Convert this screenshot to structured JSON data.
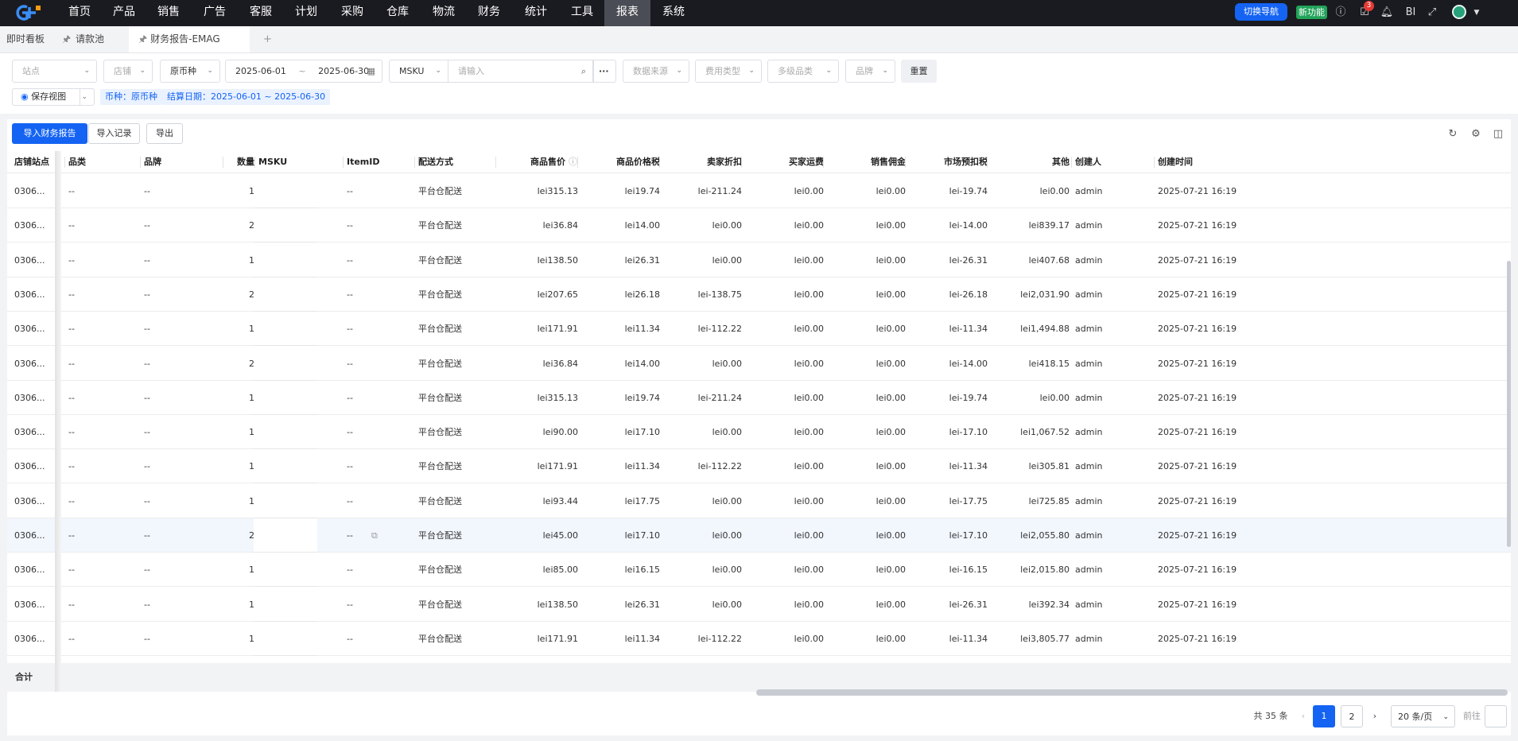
{
  "nav": {
    "items": [
      "首页",
      "产品",
      "销售",
      "广告",
      "客服",
      "计划",
      "采购",
      "仓库",
      "物流",
      "财务",
      "统计",
      "工具",
      "报表",
      "系统"
    ],
    "switch_label": "切换导航",
    "new_feature_label": "新功能",
    "notification_count": "3",
    "bi_label": "BI"
  },
  "tabs": {
    "dashboard": "即时看板",
    "request_pool": "请款池",
    "active": "财务报告-EMAG",
    "add": "+"
  },
  "filters": {
    "site": "站点",
    "shop": "店铺",
    "currency": "原币种",
    "date_start": "2025-06-01",
    "date_sep": "~",
    "date_end": "2025-06-30",
    "search_field": "MSKU",
    "search_placeholder": "请输入",
    "more": "···",
    "data_source": "数据来源",
    "fee_type": "费用类型",
    "category": "多级品类",
    "brand": "品牌",
    "reset": "重置",
    "save_view": "保存视图",
    "tag_currency": "币种：原币种",
    "tag_date": "结算日期：2025-06-01 ~ 2025-06-30"
  },
  "toolbar": {
    "import_report": "导入财务报告",
    "import_record": "导入记录",
    "export": "导出"
  },
  "table": {
    "headers": {
      "shop_site": "店铺站点",
      "category": "品类",
      "brand": "品牌",
      "qty": "数量",
      "msku": "MSKU",
      "item_id": "ItemID",
      "delivery": "配送方式",
      "price": "商品售价",
      "price_tax": "商品价格税",
      "seller_discount": "卖家折扣",
      "buyer_shipping": "买家运费",
      "commission": "销售佣金",
      "market_tax": "市场预扣税",
      "other": "其他",
      "creator": "创建人",
      "created": "创建时间"
    },
    "rows": [
      {
        "site": "0306...",
        "cat": "--",
        "brand": "--",
        "qty": "1",
        "item": "--",
        "delivery": "平台仓配送",
        "price": "lei315.13",
        "tax": "lei19.74",
        "discount": "lei-211.24",
        "ship": "lei0.00",
        "comm": "lei0.00",
        "mtax": "lei-19.74",
        "other": "lei0.00",
        "creator": "admin",
        "time": "2025-07-21 16:19..."
      },
      {
        "site": "0306...",
        "cat": "--",
        "brand": "--",
        "qty": "2",
        "item": "--",
        "delivery": "平台仓配送",
        "price": "lei36.84",
        "tax": "lei14.00",
        "discount": "lei0.00",
        "ship": "lei0.00",
        "comm": "lei0.00",
        "mtax": "lei-14.00",
        "other": "lei839.17",
        "creator": "admin",
        "time": "2025-07-21 16:19..."
      },
      {
        "site": "0306...",
        "cat": "--",
        "brand": "--",
        "qty": "1",
        "item": "--",
        "delivery": "平台仓配送",
        "price": "lei138.50",
        "tax": "lei26.31",
        "discount": "lei0.00",
        "ship": "lei0.00",
        "comm": "lei0.00",
        "mtax": "lei-26.31",
        "other": "lei407.68",
        "creator": "admin",
        "time": "2025-07-21 16:19..."
      },
      {
        "site": "0306...",
        "cat": "--",
        "brand": "--",
        "qty": "2",
        "item": "--",
        "delivery": "平台仓配送",
        "price": "lei207.65",
        "tax": "lei26.18",
        "discount": "lei-138.75",
        "ship": "lei0.00",
        "comm": "lei0.00",
        "mtax": "lei-26.18",
        "other": "lei2,031.90",
        "creator": "admin",
        "time": "2025-07-21 16:19..."
      },
      {
        "site": "0306...",
        "cat": "--",
        "brand": "--",
        "qty": "1",
        "item": "--",
        "delivery": "平台仓配送",
        "price": "lei171.91",
        "tax": "lei11.34",
        "discount": "lei-112.22",
        "ship": "lei0.00",
        "comm": "lei0.00",
        "mtax": "lei-11.34",
        "other": "lei1,494.88",
        "creator": "admin",
        "time": "2025-07-21 16:19..."
      },
      {
        "site": "0306...",
        "cat": "--",
        "brand": "--",
        "qty": "2",
        "item": "--",
        "delivery": "平台仓配送",
        "price": "lei36.84",
        "tax": "lei14.00",
        "discount": "lei0.00",
        "ship": "lei0.00",
        "comm": "lei0.00",
        "mtax": "lei-14.00",
        "other": "lei418.15",
        "creator": "admin",
        "time": "2025-07-21 16:19..."
      },
      {
        "site": "0306...",
        "cat": "--",
        "brand": "--",
        "qty": "1",
        "item": "--",
        "delivery": "平台仓配送",
        "price": "lei315.13",
        "tax": "lei19.74",
        "discount": "lei-211.24",
        "ship": "lei0.00",
        "comm": "lei0.00",
        "mtax": "lei-19.74",
        "other": "lei0.00",
        "creator": "admin",
        "time": "2025-07-21 16:19..."
      },
      {
        "site": "0306...",
        "cat": "--",
        "brand": "--",
        "qty": "1",
        "item": "--",
        "delivery": "平台仓配送",
        "price": "lei90.00",
        "tax": "lei17.10",
        "discount": "lei0.00",
        "ship": "lei0.00",
        "comm": "lei0.00",
        "mtax": "lei-17.10",
        "other": "lei1,067.52",
        "creator": "admin",
        "time": "2025-07-21 16:19..."
      },
      {
        "site": "0306...",
        "cat": "--",
        "brand": "--",
        "qty": "1",
        "item": "--",
        "delivery": "平台仓配送",
        "price": "lei171.91",
        "tax": "lei11.34",
        "discount": "lei-112.22",
        "ship": "lei0.00",
        "comm": "lei0.00",
        "mtax": "lei-11.34",
        "other": "lei305.81",
        "creator": "admin",
        "time": "2025-07-21 16:19..."
      },
      {
        "site": "0306...",
        "cat": "--",
        "brand": "--",
        "qty": "1",
        "item": "--",
        "delivery": "平台仓配送",
        "price": "lei93.44",
        "tax": "lei17.75",
        "discount": "lei0.00",
        "ship": "lei0.00",
        "comm": "lei0.00",
        "mtax": "lei-17.75",
        "other": "lei725.85",
        "creator": "admin",
        "time": "2025-07-21 16:19..."
      },
      {
        "site": "0306...",
        "cat": "--",
        "brand": "--",
        "qty": "2",
        "item": "--",
        "delivery": "平台仓配送",
        "price": "lei45.00",
        "tax": "lei17.10",
        "discount": "lei0.00",
        "ship": "lei0.00",
        "comm": "lei0.00",
        "mtax": "lei-17.10",
        "other": "lei2,055.80",
        "creator": "admin",
        "time": "2025-07-21 16:19...",
        "highlight": true
      },
      {
        "site": "0306...",
        "cat": "--",
        "brand": "--",
        "qty": "1",
        "item": "--",
        "delivery": "平台仓配送",
        "price": "lei85.00",
        "tax": "lei16.15",
        "discount": "lei0.00",
        "ship": "lei0.00",
        "comm": "lei0.00",
        "mtax": "lei-16.15",
        "other": "lei2,015.80",
        "creator": "admin",
        "time": "2025-07-21 16:19..."
      },
      {
        "site": "0306...",
        "cat": "--",
        "brand": "--",
        "qty": "1",
        "item": "--",
        "delivery": "平台仓配送",
        "price": "lei138.50",
        "tax": "lei26.31",
        "discount": "lei0.00",
        "ship": "lei0.00",
        "comm": "lei0.00",
        "mtax": "lei-26.31",
        "other": "lei392.34",
        "creator": "admin",
        "time": "2025-07-21 16:19..."
      },
      {
        "site": "0306...",
        "cat": "--",
        "brand": "--",
        "qty": "1",
        "item": "--",
        "delivery": "平台仓配送",
        "price": "lei171.91",
        "tax": "lei11.34",
        "discount": "lei-112.22",
        "ship": "lei0.00",
        "comm": "lei0.00",
        "mtax": "lei-11.34",
        "other": "lei3,805.77",
        "creator": "admin",
        "time": "2025-07-21 16:19..."
      }
    ],
    "total_label": "合计"
  },
  "pagination": {
    "total": "共 35 条",
    "prev": "‹",
    "pages": [
      "1",
      "2"
    ],
    "current": "1",
    "next": "›",
    "page_size": "20 条/页",
    "goto": "前往"
  },
  "colors": {
    "accent": "#1463f3",
    "topbar": "#1a1b20",
    "new_badge": "#22a35a"
  }
}
